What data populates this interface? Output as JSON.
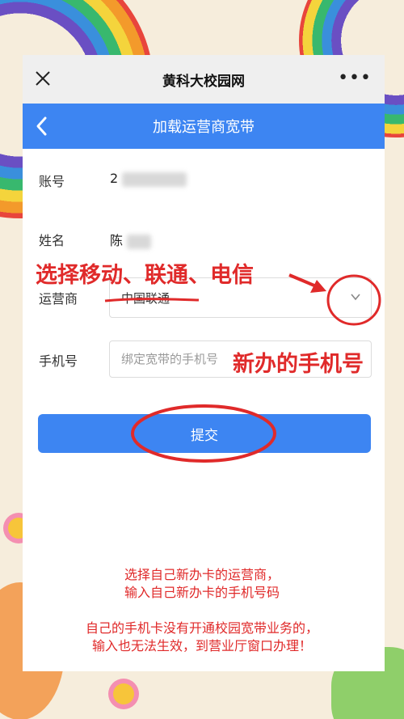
{
  "window": {
    "title": "黄科大校园网",
    "close_icon": "close-icon",
    "more_label": "•••"
  },
  "navbar": {
    "title": "加载运营商宽带",
    "back_icon": "chevron-left-icon"
  },
  "form": {
    "account_label": "账号",
    "account_value": "2",
    "name_label": "姓名",
    "name_value": "陈",
    "carrier_label": "运营商",
    "carrier_value": "中国联通",
    "phone_label": "手机号",
    "phone_placeholder": "绑定宽带的手机号",
    "submit_label": "提交"
  },
  "annotations": {
    "select_carrier": "选择移动、联通、电信",
    "new_phone": "新办的手机号",
    "note_line1": "选择自己新办卡的运营商，",
    "note_line2": "输入自己新办卡的手机号码",
    "note_line3": "自己的手机卡没有开通校园宽带业务的，",
    "note_line4": "输入也无法生效，到营业厅窗口办理！"
  },
  "colors": {
    "accent": "#3d85f2",
    "annotation": "#e02a2a"
  }
}
